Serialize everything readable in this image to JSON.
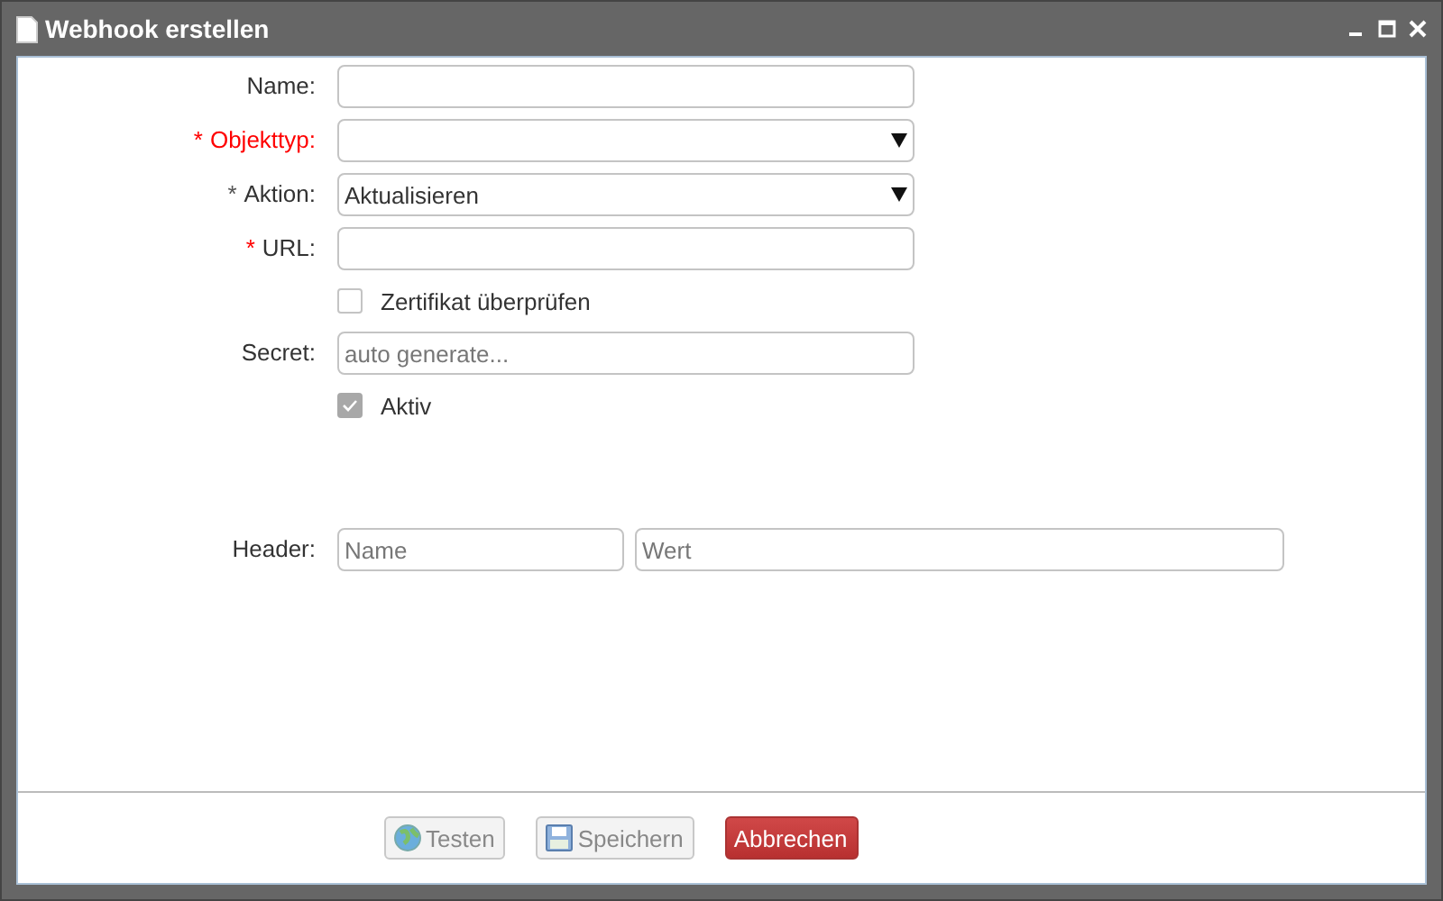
{
  "window": {
    "title": "Webhook erstellen"
  },
  "form": [
    {
      "kind": "text",
      "label": "Name:",
      "invalid": false
    },
    {
      "kind": "select",
      "label": "Objekttyp:",
      "star": {
        "text": "*",
        "color": "#ff0000"
      },
      "invalid": true
    },
    {
      "kind": "select",
      "label": "Aktion:",
      "star": {
        "text": "*",
        "color": "#555555"
      },
      "invalid": false,
      "value": "Aktualisieren"
    },
    {
      "kind": "text",
      "label": "URL:",
      "star": {
        "text": "*",
        "color": "#ff0000"
      },
      "invalid": false
    },
    {
      "kind": "checkbox",
      "label": "Zertifikat überprüfen",
      "checked": false
    },
    {
      "kind": "text",
      "label": "Secret:",
      "invalid": false,
      "placeholder": "auto generate..."
    },
    {
      "kind": "checkbox",
      "label": "Aktiv",
      "checked": true
    }
  ],
  "header": {
    "label": "Header:",
    "name_placeholder": "Name",
    "value_placeholder": "Wert"
  },
  "buttons": [
    {
      "label": "Testen",
      "kind": "globe",
      "disabled": true
    },
    {
      "label": "Speichern",
      "kind": "save",
      "disabled": true
    },
    {
      "label": "Abbrechen",
      "kind": "danger",
      "disabled": false
    }
  ]
}
